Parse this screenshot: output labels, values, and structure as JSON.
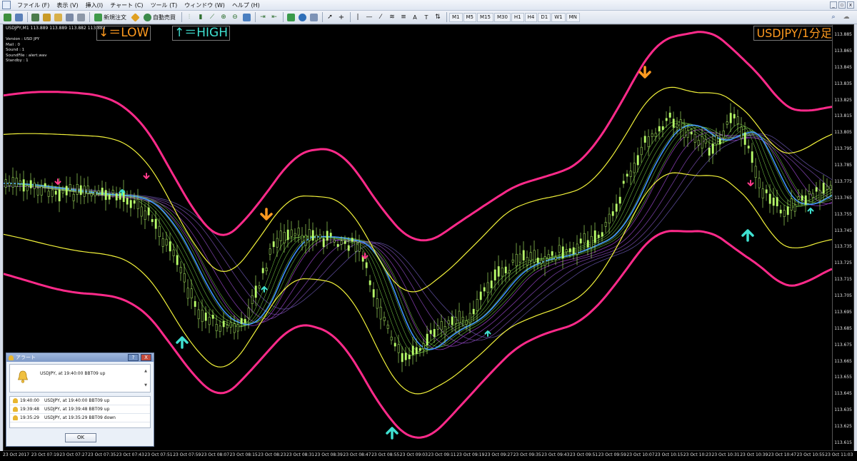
{
  "menu": {
    "items": [
      "ファイル (F)",
      "表示 (V)",
      "挿入(I)",
      "チャート (C)",
      "ツール (T)",
      "ウィンドウ (W)",
      "ヘルプ (H)"
    ]
  },
  "toolbar": {
    "new_order": "新規注文",
    "auto_trade": "自動売買",
    "timeframes": [
      "M1",
      "M5",
      "M15",
      "M30",
      "H1",
      "H4",
      "D1",
      "W1",
      "MN"
    ]
  },
  "chart": {
    "title": "USDJPY,M1  113.889 113.889 113.882 113.883",
    "info": [
      "Version : USD JPY",
      "Mail : 0",
      "Sound : 1",
      "SoundFile : alert.wav",
      "Standby : 1"
    ],
    "legend_low": "↓＝LOW",
    "legend_high": "↑＝HIGH",
    "symbol_tag": "USDJPY/1分足",
    "price_ticks": [
      "113.885",
      "113.865",
      "113.845",
      "113.835",
      "113.825",
      "113.815",
      "113.805",
      "113.795",
      "113.785",
      "113.775",
      "113.765",
      "113.755",
      "113.745",
      "113.735",
      "113.725",
      "113.715",
      "113.705",
      "113.695",
      "113.685",
      "113.675",
      "113.665",
      "113.655",
      "113.645",
      "113.635",
      "113.625",
      "113.615"
    ],
    "time_ticks": [
      "23 Oct 2017",
      "23 Oct 07:19",
      "23 Oct 07:27",
      "23 Oct 07:35",
      "23 Oct 07:43",
      "23 Oct 07:51",
      "23 Oct 07:59",
      "23 Oct 08:07",
      "23 Oct 08:15",
      "23 Oct 08:23",
      "23 Oct 08:31",
      "23 Oct 08:39",
      "23 Oct 08:47",
      "23 Oct 08:55",
      "23 Oct 09:03",
      "23 Oct 09:11",
      "23 Oct 09:19",
      "23 Oct 09:27",
      "23 Oct 09:35",
      "23 Oct 09:43",
      "23 Oct 09:51",
      "23 Oct 09:59",
      "23 Oct 10:07",
      "23 Oct 10:15",
      "23 Oct 10:23",
      "23 Oct 10:31",
      "23 Oct 10:39",
      "23 Oct 10:47",
      "23 Oct 10:55",
      "23 Oct 11:03"
    ],
    "colors": {
      "outer_band": "#ff2a8a",
      "inner_band": "#f2f23a",
      "ma_fast": "#3f8fff",
      "candle": "#b8ff6a",
      "arrow_low": "#ff9a1f",
      "arrow_high": "#3fe0d0",
      "arrow_small_down": "#ff3a8a"
    }
  },
  "alert": {
    "title": "アラート",
    "message": "USDJPY, at 19:40:00 BBT09 up",
    "log": [
      {
        "time": "19:40:00",
        "text": "USDJPY, at 19:40:00 BBT09 up"
      },
      {
        "time": "19:39:48",
        "text": "USDJPY, at 19:39:48 BBT09 up"
      },
      {
        "time": "19:35:29",
        "text": "USDJPY, at 19:35:29 BBT09 down"
      }
    ],
    "ok_label": "OK",
    "help_label": "?",
    "close_label": "X"
  }
}
